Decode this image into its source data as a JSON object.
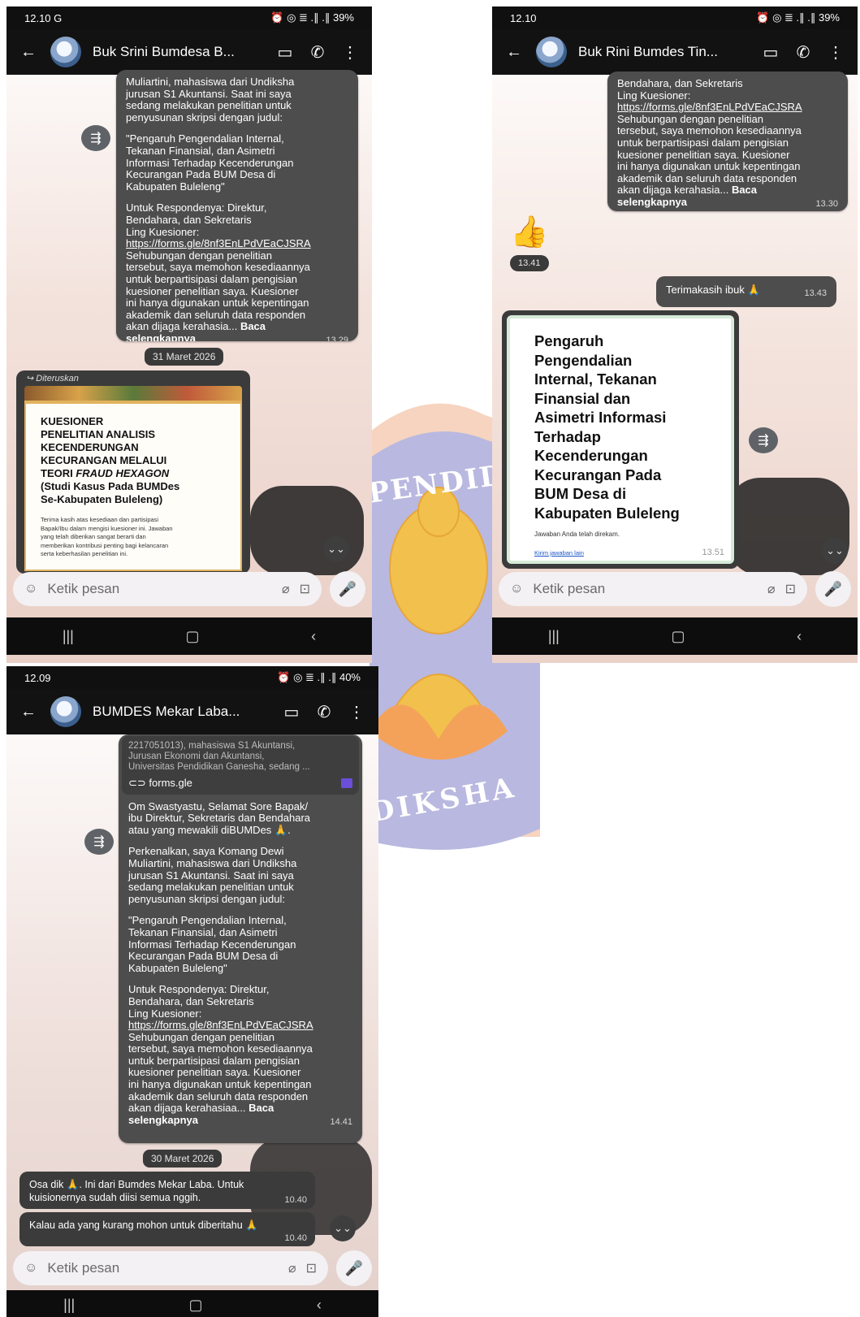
{
  "watermark": {
    "arc_top": "PENDIDI",
    "arc_bottom": "DIKSHA"
  },
  "p1": {
    "status": {
      "time": "12.10 G",
      "icons": "⏰ ◎ ≣ .∥ .∥ 39%"
    },
    "header": {
      "title": "Buk Srini Bumdesa B..."
    },
    "message": {
      "p1": "Muliartini, mahasiswa dari Undiksha\njurusan S1 Akuntansi. Saat ini saya\nsedang melakukan penelitian untuk\npenyusunan skripsi dengan judul:",
      "p2": "\"Pengaruh Pengendalian Internal,\nTekanan Finansial, dan Asimetri\nInformasi Terhadap Kecenderungan\nKecurangan Pada BUM Desa di\nKabupaten Buleleng\"",
      "p3": "Untuk Respondenya: Direktur,\nBendahara, dan Sekretaris\nLing Kuesioner:",
      "link": "https://forms.gle/8nf3EnLPdVEaCJSRA",
      "p4": "Sehubungan dengan penelitian\ntersebut, saya memohon kesediaannya\nuntuk berpartisipasi dalam pengisian\nkuesioner penelitian saya. Kuesioner\nini hanya digunakan untuk kepentingan\nakademik dan seluruh data responden\nakan dijaga kerahasia... ",
      "more": "Baca\nselengkapnya",
      "time": "13.29"
    },
    "date_chip": "31 Maret 2026",
    "forwarded": {
      "label": "Diteruskan",
      "title_a": "KUESIONER\nPENELITIAN ANALISIS\nKECENDERUNGAN\nKECURANGAN MELALUI\nTEORI ",
      "title_em": "FRAUD HEXAGON",
      "title_b": "\n(Studi Kasus Pada BUMDes\nSe-Kabupaten Buleleng)",
      "body": "Terima kasih atas kesediaan dan partisipasi\nBapak/Ibu dalam mengisi kuesioner ini. Jawaban\nyang telah diberikan sangat berarti dan\nmemberikan kontribusi penting bagi kelancaran\nserta keberhasilan penelitian ini."
    },
    "input_placeholder": "Ketik pesan"
  },
  "p2": {
    "status": {
      "time": "12.10",
      "icons": "⏰ ◎ ≣ .∥ .∥ 39%"
    },
    "header": {
      "title": "Buk Rini Bumdes Tin..."
    },
    "message": {
      "p1": "Bendahara, dan Sekretaris\nLing Kuesioner:",
      "link": "https://forms.gle/8nf3EnLPdVEaCJSRA",
      "p2": "Sehubungan dengan penelitian\ntersebut, saya memohon kesediaannya\nuntuk berpartisipasi dalam pengisian\nkuesioner penelitian saya. Kuesioner\nini hanya digunakan untuk kepentingan\nakademik dan seluruh data responden\nakan dijaga kerahasia... ",
      "more": "Baca\nselengkapnya",
      "time": "13.30"
    },
    "sticker": "👍",
    "sticker_time": "13.41",
    "outgoing": {
      "text": "Terimakasih ibuk 🙏",
      "time": "13.43"
    },
    "card": {
      "title": "Pengaruh\nPengendalian\nInternal, Tekanan\nFinansial dan\nAsimetri Informasi\nTerhadap\nKecenderungan\nKecurangan Pada\nBUM Desa di\nKabupaten Buleleng",
      "recorded": "Jawaban Anda telah direkam.",
      "link": "Kirim jawaban lain",
      "time": "13.51"
    },
    "input_placeholder": "Ketik pesan"
  },
  "p3": {
    "status": {
      "time": "12.09",
      "icons": "⏰ ◎ ≣ .∥ .∥ 40%"
    },
    "header": {
      "title": "BUMDES Mekar Laba..."
    },
    "message": {
      "preview": "2217051013), mahasiswa S1 Akuntansi,\nJurusan Ekonomi dan Akuntansi,\nUniversitas Pendidikan Ganesha, sedang ...",
      "linkchip": "forms.gle",
      "p1": "Om Swastyastu, Selamat Sore Bapak/\nibu Direktur, Sekretaris dan Bendahara\natau yang mewakili diBUMDes 🙏.",
      "p2": "Perkenalkan, saya Komang Dewi\nMuliartini, mahasiswa dari Undiksha\njurusan S1 Akuntansi. Saat ini saya\nsedang melakukan penelitian untuk\npenyusunan skripsi dengan judul:",
      "p3": "\"Pengaruh Pengendalian Internal,\nTekanan Finansial, dan Asimetri\nInformasi Terhadap Kecenderungan\nKecurangan Pada BUM Desa di\nKabupaten Buleleng\"",
      "p4": "Untuk Respondenya: Direktur,\nBendahara, dan Sekretaris\nLing Kuesioner:",
      "link": "https://forms.gle/8nf3EnLPdVEaCJSRA",
      "p5": "Sehubungan dengan penelitian\ntersebut, saya memohon kesediaannya\nuntuk berpartisipasi dalam pengisian\nkuesioner penelitian saya. Kuesioner\nini hanya digunakan untuk kepentingan\nakademik dan seluruh data responden\nakan dijaga kerahasiaa... ",
      "more": "Baca\nselengkapnya",
      "time": "14.41"
    },
    "date_chip": "30 Maret 2026",
    "reply1": {
      "text": "Osa dik 🙏. Ini dari Bumdes Mekar Laba. Untuk\nkuisionernya sudah diisi semua nggih.",
      "time": "10.40"
    },
    "reply2": {
      "text": "Kalau ada yang kurang mohon untuk diberitahu 🙏",
      "time": "10.40"
    },
    "input_placeholder": "Ketik pesan"
  }
}
